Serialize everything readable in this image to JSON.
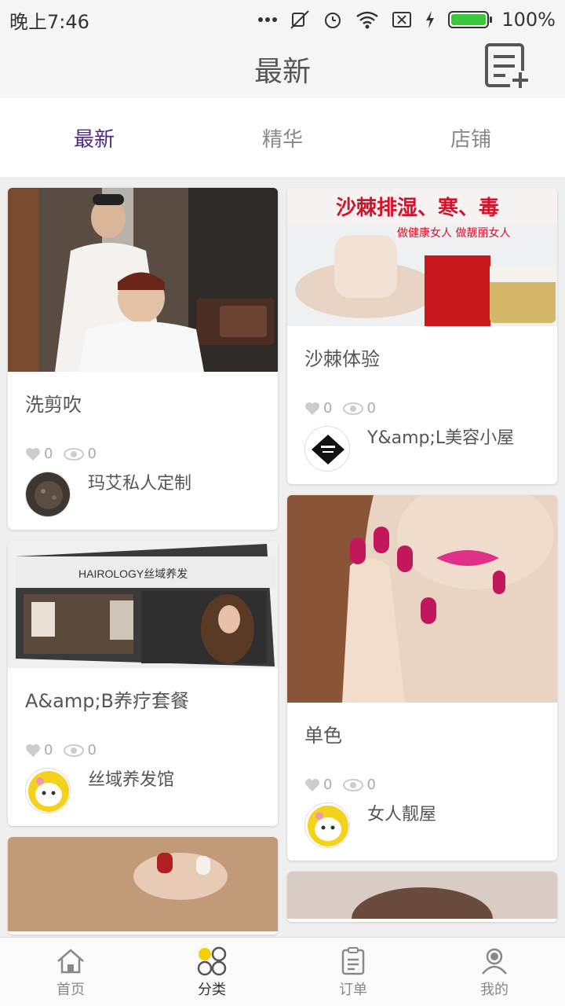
{
  "status_bar": {
    "time": "晚上7:46",
    "battery": "100%",
    "icons": [
      "more-dots-icon",
      "mute-icon",
      "alarm-icon",
      "wifi-icon",
      "no-sim-icon",
      "charging-icon",
      "battery-icon"
    ]
  },
  "header": {
    "title": "最新",
    "compose_icon": "compose-icon"
  },
  "tabs": [
    {
      "label": "最新",
      "active": true
    },
    {
      "label": "精华",
      "active": false
    },
    {
      "label": "店铺",
      "active": false
    }
  ],
  "feed": {
    "left": [
      {
        "title": "洗剪吹",
        "likes": "0",
        "views": "0",
        "shop": "玛艾私人定制"
      },
      {
        "title": "A&amp;B养疗套餐",
        "likes": "0",
        "views": "0",
        "shop": "丝域养发馆",
        "image_text": "HAIROLOGY丝域养发"
      }
    ],
    "right": [
      {
        "title": "沙棘体验",
        "likes": "0",
        "views": "0",
        "shop": "Y&amp;L美容小屋",
        "image_text": "沙棘排湿、寒、毒",
        "image_subtext": "做健康女人 做靓丽女人"
      },
      {
        "title": "单色",
        "likes": "0",
        "views": "0",
        "shop": "女人靓屋"
      }
    ]
  },
  "bottom_nav": [
    {
      "label": "首页",
      "icon": "home-icon",
      "active": false
    },
    {
      "label": "分类",
      "icon": "category-icon",
      "active": true
    },
    {
      "label": "订单",
      "icon": "order-icon",
      "active": false
    },
    {
      "label": "我的",
      "icon": "profile-icon",
      "active": false
    }
  ],
  "colors": {
    "accent": "#4a2b8a",
    "category_yellow": "#f5d000"
  }
}
